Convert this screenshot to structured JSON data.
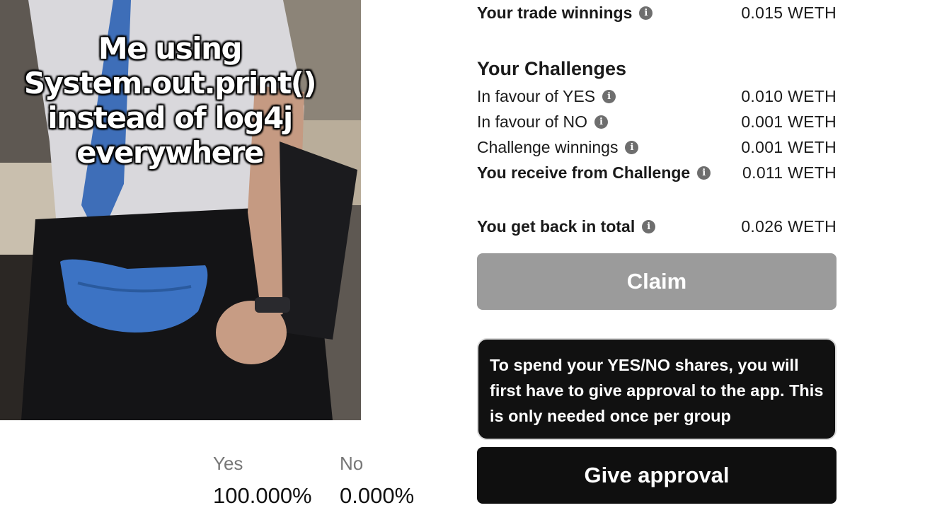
{
  "meme": {
    "caption_lines": [
      "Me using",
      "System.out.print()",
      "instead of log4j",
      "everywhere"
    ]
  },
  "odds": {
    "yes_label": "Yes",
    "yes_value": "100.000%",
    "no_label": "No",
    "no_value": "0.000%"
  },
  "summary": {
    "trade_winnings": {
      "label": "Your trade winnings",
      "value": "0.015 WETH"
    },
    "challenges_title": "Your Challenges",
    "favour_yes": {
      "label": "In favour of YES",
      "value": "0.010 WETH"
    },
    "favour_no": {
      "label": "In favour of NO",
      "value": "0.001 WETH"
    },
    "challenge_winnings": {
      "label": "Challenge winnings",
      "value": "0.001 WETH"
    },
    "receive_from_challenge": {
      "label": "You receive from Challenge",
      "value": "0.011 WETH"
    },
    "total": {
      "label": "You get back in total",
      "value": "0.026 WETH"
    }
  },
  "actions": {
    "claim_label": "Claim",
    "approval_notice": "To spend your YES/NO shares, you will first have to give approval to the app. This is only needed once per group",
    "give_approval_label": "Give approval"
  },
  "colors": {
    "claim_disabled": "#9b9b9b",
    "primary_dark": "#0f0f0f",
    "info_icon": "#6e6e6e"
  },
  "icons": {
    "info": "info-icon"
  }
}
